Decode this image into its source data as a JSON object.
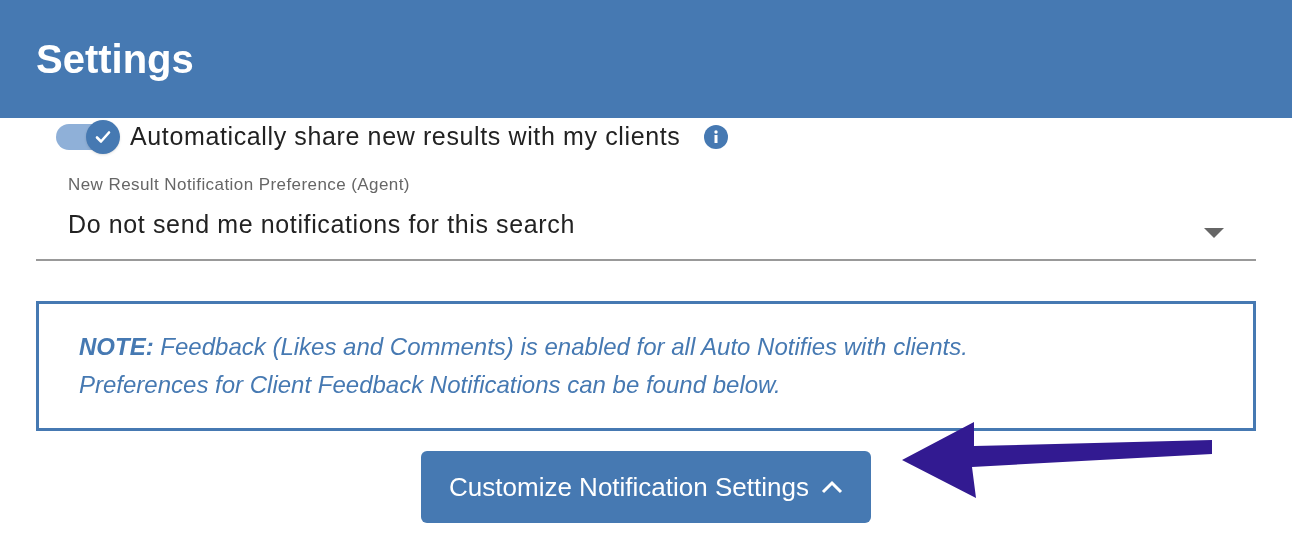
{
  "header": {
    "title": "Settings"
  },
  "auto_share": {
    "label": "Automatically share new results with my clients",
    "on": true
  },
  "preference": {
    "label": "New Result Notification Preference (Agent)",
    "value": "Do not send me notifications for this search"
  },
  "note": {
    "text": "**NOTE:**  Feedback (Likes and Comments) is enabled for all Auto Notifies with clients. Preferences for Client Feedback Notifications can be found below."
  },
  "customize_button": {
    "label": "Customize Notification Settings",
    "expanded": true
  }
}
